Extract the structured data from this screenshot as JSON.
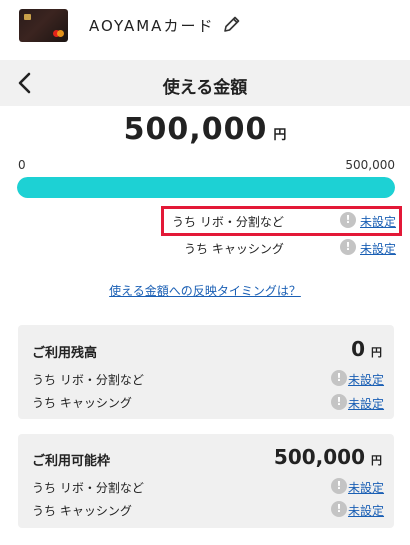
{
  "header": {
    "card_name": "AOYAMAカード",
    "icons": {
      "edit": "pencil-icon"
    }
  },
  "nav": {
    "title": "使える金額",
    "icons": {
      "back": "chevron-left-icon"
    }
  },
  "available": {
    "amount": "500,000",
    "unit": "円",
    "axis_min": "0",
    "axis_max": "500,000",
    "fill_fraction": 1.0,
    "colors": {
      "fill": "#1dd1d4",
      "track": "#e6e6e6",
      "highlight": "#e31837"
    },
    "rows": [
      {
        "label": "うち リボ・分割など",
        "status": "未設定"
      },
      {
        "label": "うち キャッシング",
        "status": "未設定"
      }
    ],
    "info_glyph": "!",
    "timing_link": "使える金額への反映タイミングは？"
  },
  "balance": {
    "title": "ご利用残高",
    "value": "0",
    "unit": "円",
    "rows": [
      {
        "label": "うち リボ・分割など",
        "status": "未設定"
      },
      {
        "label": "うち キャッシング",
        "status": "未設定"
      }
    ]
  },
  "limit": {
    "title": "ご利用可能枠",
    "value": "500,000",
    "unit": "円",
    "rows": [
      {
        "label": "うち リボ・分割など",
        "status": "未設定"
      },
      {
        "label": "うち キャッシング",
        "status": "未設定"
      }
    ]
  }
}
